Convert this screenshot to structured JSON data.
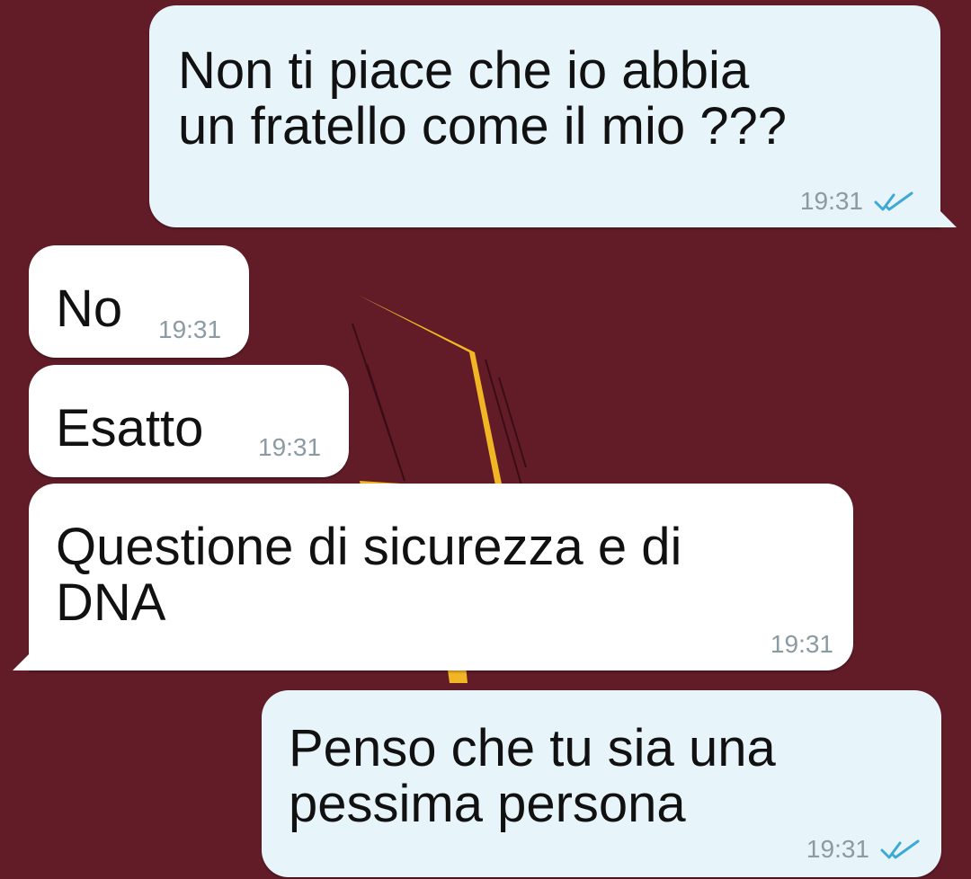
{
  "chat": {
    "messages": [
      {
        "direction": "outgoing",
        "text": "Non ti piace che io abbia\nun fratello come il mio ???",
        "time": "19:31",
        "status_icon": "double-check-icon"
      },
      {
        "direction": "incoming",
        "text": "No",
        "time": "19:31"
      },
      {
        "direction": "incoming",
        "text": "Esatto",
        "time": "19:31"
      },
      {
        "direction": "incoming",
        "text": "Questione di sicurezza e di\nDNA",
        "time": "19:31"
      },
      {
        "direction": "outgoing",
        "text": "Penso che tu sia una\npessima persona",
        "time": "19:31",
        "status_icon": "double-check-icon"
      }
    ]
  },
  "colors": {
    "background": "#611c28",
    "outgoing_bubble": "#e7f4fa",
    "incoming_bubble": "#ffffff",
    "wallpaper_accent": "#f2b625",
    "read_tick": "#3fa9d6",
    "timestamp": "#8a9ba3"
  },
  "icons": {
    "wallpaper": "lightning-bolt-icon",
    "read_status": "double-check-icon"
  }
}
